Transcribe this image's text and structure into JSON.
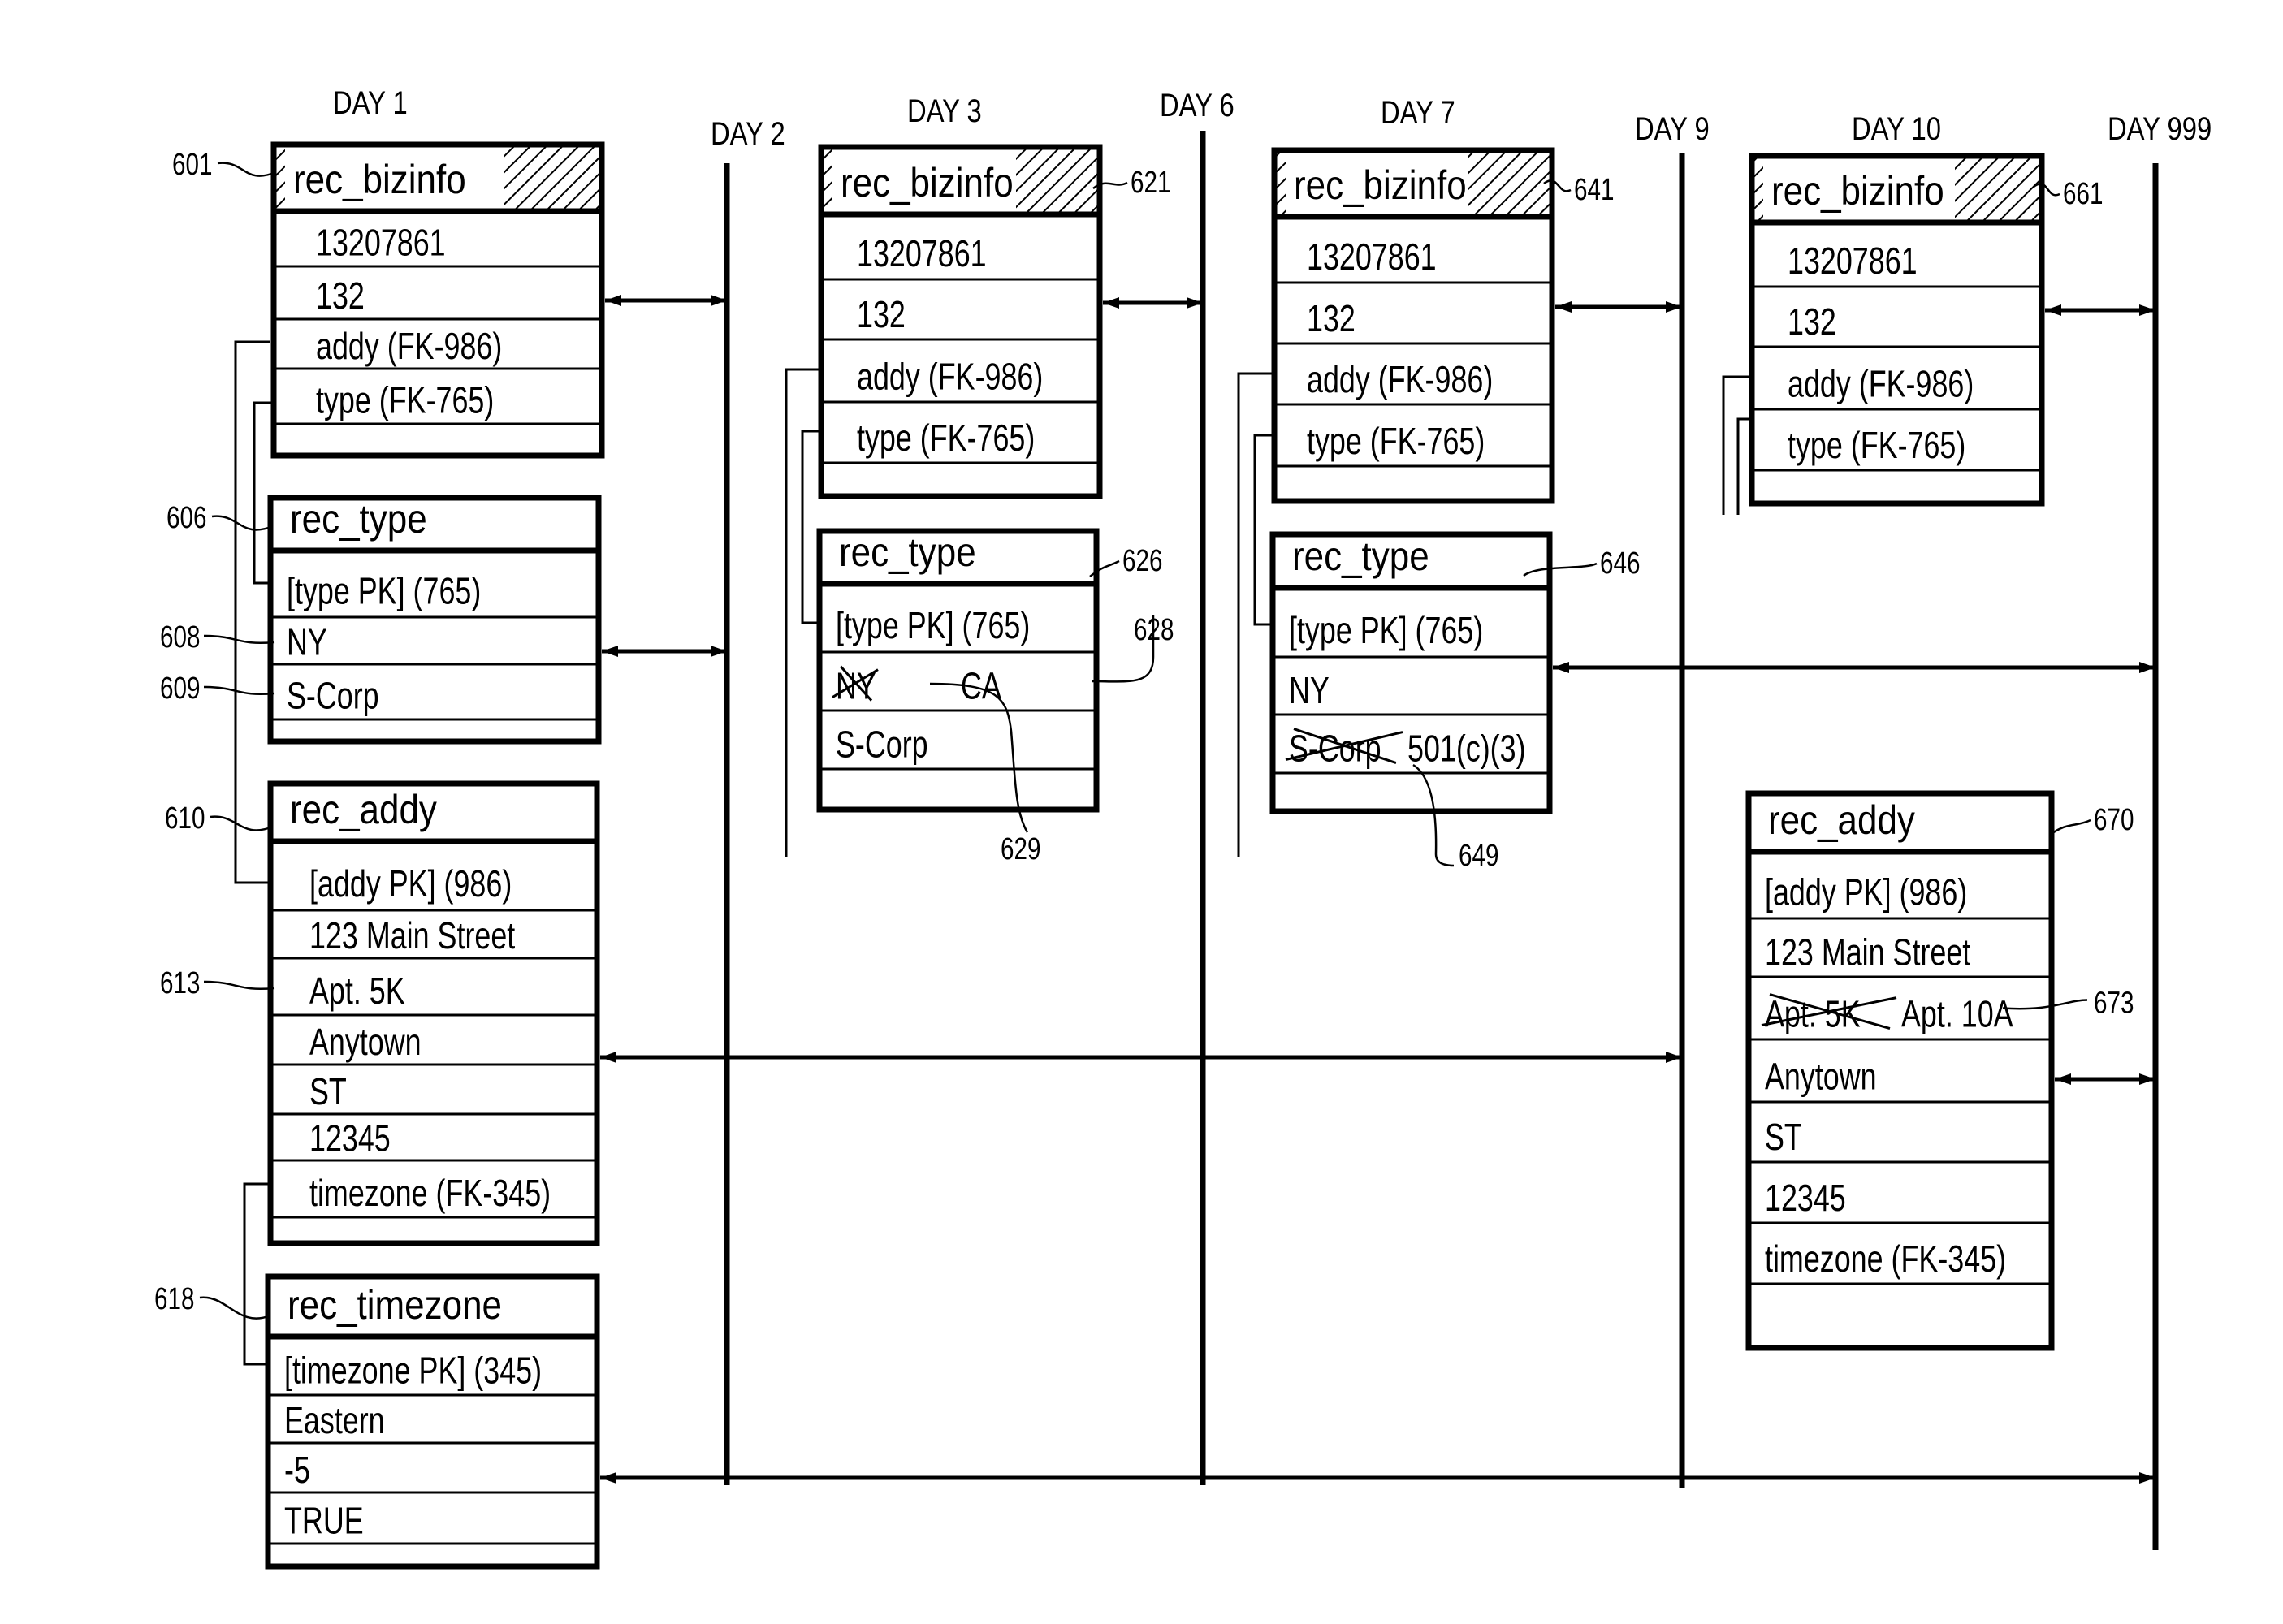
{
  "figure": {
    "type": "temporal database record versioning diagram",
    "days": [
      {
        "id": "day1",
        "label": "DAY 1"
      },
      {
        "id": "day2",
        "label": "DAY 2"
      },
      {
        "id": "day3",
        "label": "DAY 3"
      },
      {
        "id": "day6",
        "label": "DAY 6"
      },
      {
        "id": "day7",
        "label": "DAY 7"
      },
      {
        "id": "day9",
        "label": "DAY 9"
      },
      {
        "id": "day10",
        "label": "DAY 10"
      },
      {
        "id": "day999",
        "label": "DAY 999"
      }
    ],
    "records": [
      {
        "id": "b601",
        "ref": "601",
        "title": "rec_bizinfo",
        "hatched": true,
        "day": "DAY 1",
        "fields": [
          {
            "text": "13207861"
          },
          {
            "text": "132"
          },
          {
            "text": "addy (FK-986)"
          },
          {
            "text": "type (FK-765)"
          },
          {
            "text": ""
          }
        ]
      },
      {
        "id": "t606",
        "ref": "606",
        "title": "rec_type",
        "hatched": false,
        "day": "DAY 1",
        "fields": [
          {
            "text": "[type PK]  (765)"
          },
          {
            "text": "NY",
            "ref": "608"
          },
          {
            "text": "S-Corp",
            "ref": "609"
          },
          {
            "text": ""
          }
        ]
      },
      {
        "id": "a610",
        "ref": "610",
        "title": "rec_addy",
        "hatched": false,
        "day": "DAY 1",
        "fields": [
          {
            "text": "[addy PK]  (986)"
          },
          {
            "text": "123 Main Street"
          },
          {
            "text": "Apt. 5K",
            "ref": "613"
          },
          {
            "text": "Anytown"
          },
          {
            "text": "ST"
          },
          {
            "text": "12345"
          },
          {
            "text": "timezone  (FK-345)"
          },
          {
            "text": ""
          }
        ]
      },
      {
        "id": "z618",
        "ref": "618",
        "title": "rec_timezone",
        "hatched": false,
        "day": "DAY 1",
        "fields": [
          {
            "text": "[timezone PK] (345)"
          },
          {
            "text": "Eastern"
          },
          {
            "text": "-5"
          },
          {
            "text": "TRUE"
          },
          {
            "text": ""
          }
        ]
      },
      {
        "id": "b621",
        "ref": "621",
        "title": "rec_bizinfo",
        "hatched": true,
        "day": "DAY 3",
        "fields": [
          {
            "text": "13207861"
          },
          {
            "text": "132"
          },
          {
            "text": "addy (FK-986)"
          },
          {
            "text": "type (FK-765)"
          },
          {
            "text": ""
          }
        ]
      },
      {
        "id": "t626",
        "ref": "626",
        "title": "rec_type",
        "hatched": false,
        "day": "DAY 3",
        "fields": [
          {
            "text": "[type PK]  (765)"
          },
          {
            "struck": "NY",
            "text": "CA",
            "ref": "628",
            "ref_struck": "629"
          },
          {
            "text": "S-Corp"
          },
          {
            "text": ""
          }
        ]
      },
      {
        "id": "b641",
        "ref": "641",
        "title": "rec_bizinfo",
        "hatched": true,
        "day": "DAY 7",
        "fields": [
          {
            "text": "13207861"
          },
          {
            "text": "132"
          },
          {
            "text": "addy (FK-986)"
          },
          {
            "text": "type (FK-765)"
          },
          {
            "text": ""
          }
        ]
      },
      {
        "id": "t646",
        "ref": "646",
        "title": "rec_type",
        "hatched": false,
        "day": "DAY 7",
        "fields": [
          {
            "text": "[type PK]  (765)"
          },
          {
            "text": "NY"
          },
          {
            "struck": "S-Corp",
            "text": "501(c)(3)",
            "ref": "649"
          },
          {
            "text": ""
          }
        ]
      },
      {
        "id": "b661",
        "ref": "661",
        "title": "rec_bizinfo",
        "hatched": true,
        "day": "DAY 10",
        "fields": [
          {
            "text": "13207861"
          },
          {
            "text": "132"
          },
          {
            "text": "addy (FK-986)"
          },
          {
            "text": "type (FK-765)"
          },
          {
            "text": ""
          }
        ]
      },
      {
        "id": "a670",
        "ref": "670",
        "title": "rec_addy",
        "hatched": false,
        "day": "DAY 10",
        "fields": [
          {
            "text": "[addy PK]  (986)"
          },
          {
            "text": "123 Main Street"
          },
          {
            "struck": "Apt. 5K",
            "text": "Apt. 10A",
            "ref": "673"
          },
          {
            "text": "Anytown"
          },
          {
            "text": "ST"
          },
          {
            "text": "12345"
          },
          {
            "text": "timezone  (FK-345)"
          },
          {
            "text": ""
          }
        ]
      }
    ],
    "validity_arrows": [
      {
        "record": "601",
        "from": "DAY 1",
        "to": "DAY 2"
      },
      {
        "record": "606",
        "from": "DAY 1",
        "to": "DAY 2"
      },
      {
        "record": "610",
        "from": "DAY 1",
        "to": "DAY 9"
      },
      {
        "record": "618",
        "from": "DAY 1",
        "to": "DAY 999"
      },
      {
        "record": "621",
        "from": "DAY 3",
        "to": "DAY 6"
      },
      {
        "record": "641",
        "from": "DAY 7",
        "to": "DAY 9"
      },
      {
        "record": "646",
        "from": "DAY 7",
        "to": "DAY 999"
      },
      {
        "record": "661",
        "from": "DAY 10",
        "to": "DAY 999"
      },
      {
        "record": "670",
        "from": "DAY 10",
        "to": "DAY 999"
      }
    ]
  }
}
